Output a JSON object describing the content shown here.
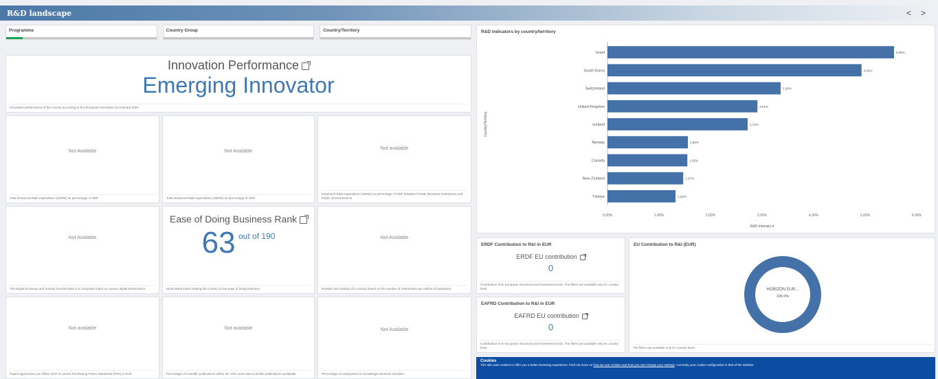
{
  "app": {
    "title": "R&D landscape",
    "nav_prev": "<",
    "nav_next": ">"
  },
  "filters": [
    {
      "label": "Programme"
    },
    {
      "label": "Country Group"
    },
    {
      "label": "Country/Territory"
    }
  ],
  "innovation": {
    "title": "Innovation Performance",
    "value": "Emerging Innovator",
    "footnote": "Innovation performance of the country according to the European Innovation Scoreboard 2024"
  },
  "kpis": [
    {
      "value": "Not Available",
      "footnote": "Total intramural R&D expenditure (GERD) as percentage of GDP"
    },
    {
      "value": "Not Available",
      "footnote": "Total intramural R&D expenditure (GERD) as percentage of GDP"
    },
    {
      "value": "Not available",
      "footnote": "Intramural R&D expenditure (GERD) as percentage of GDP between Private (Business Enterprise) and Public (Government &"
    },
    {
      "value": "Not Available",
      "footnote": "The Digital Economy and Society Overall Index is a composite index on country digital performance"
    },
    {
      "value": "",
      "footnote": "World Bank index ranking the country on the ease of doing business"
    },
    {
      "value": "Not Available",
      "footnote": "Number and ranking of a country based on the number of researchers per million of population"
    },
    {
      "value": "Not available",
      "footnote": "Patent applications per billion GDP in current Purchasing Power Standards (PPS) in EUR"
    },
    {
      "value": "Not available",
      "footnote": "Percentage of scientific publications within the 10% most cited scientific publications worldwide"
    },
    {
      "value": "Not Available",
      "footnote": "Percentage of employment in Knowledge-intensive activities"
    }
  ],
  "ease": {
    "title": "Ease of Doing Business Rank",
    "rank": "63",
    "suffix": "out of 190"
  },
  "bar_chart_title": "R&D indicators by country/territory",
  "chart_data": {
    "type": "bar",
    "orientation": "horizontal",
    "title": "R&D indicators by country/territory",
    "ylabel": "Country/Territory",
    "xlabel": "R&D intensity",
    "xlim": [
      0,
      6
    ],
    "ticks": [
      "0,00%",
      "1,00%",
      "2,00%",
      "3,00%",
      "4,00%",
      "5,00%",
      "6,00%"
    ],
    "categories": [
      "Israel",
      "South Korea",
      "Switzerland",
      "United Kingdom",
      "Iceland",
      "Norway",
      "Canada",
      "New Zealand",
      "Türkiye"
    ],
    "values": [
      5.56,
      4.93,
      3.36,
      2.91,
      2.72,
      1.56,
      1.55,
      1.47,
      1.32
    ],
    "labels": [
      "5,56%",
      "4,93%",
      "3,36%",
      "2,91%",
      "2,72%",
      "1,56%",
      "1,55%",
      "1,47%",
      "1,32%"
    ],
    "color": "#4472a8"
  },
  "erdf": {
    "title": "ERDF Contribution to R&I in EUR",
    "kpi_label": "ERDF EU contribution",
    "value": "0",
    "footnote": "Contribution from European Structural and Investment funds. The filters are available only for country level."
  },
  "eafrd": {
    "title": "EAFRD Contribution to R&I in EUR",
    "kpi_label": "EAFRD EU contribution",
    "value": "0",
    "footnote": "Contribution from European Structural and Investment funds. The filters are available only for country level."
  },
  "donut": {
    "title": "EU Contribution to R&I (EUR)",
    "center_label": "HORIZON EUR...",
    "center_value": "100.0%",
    "footnote": "The filters are available only for country level.",
    "color": "#4472a8"
  },
  "cookie": {
    "title": "Cookies",
    "text_start": "This site uses cookies to offer you a better browsing experience. Find out more on ",
    "link1": "how we use cookies and how you can change your settings",
    "text_end": ". Currently your cookie configuration is that of the website."
  }
}
